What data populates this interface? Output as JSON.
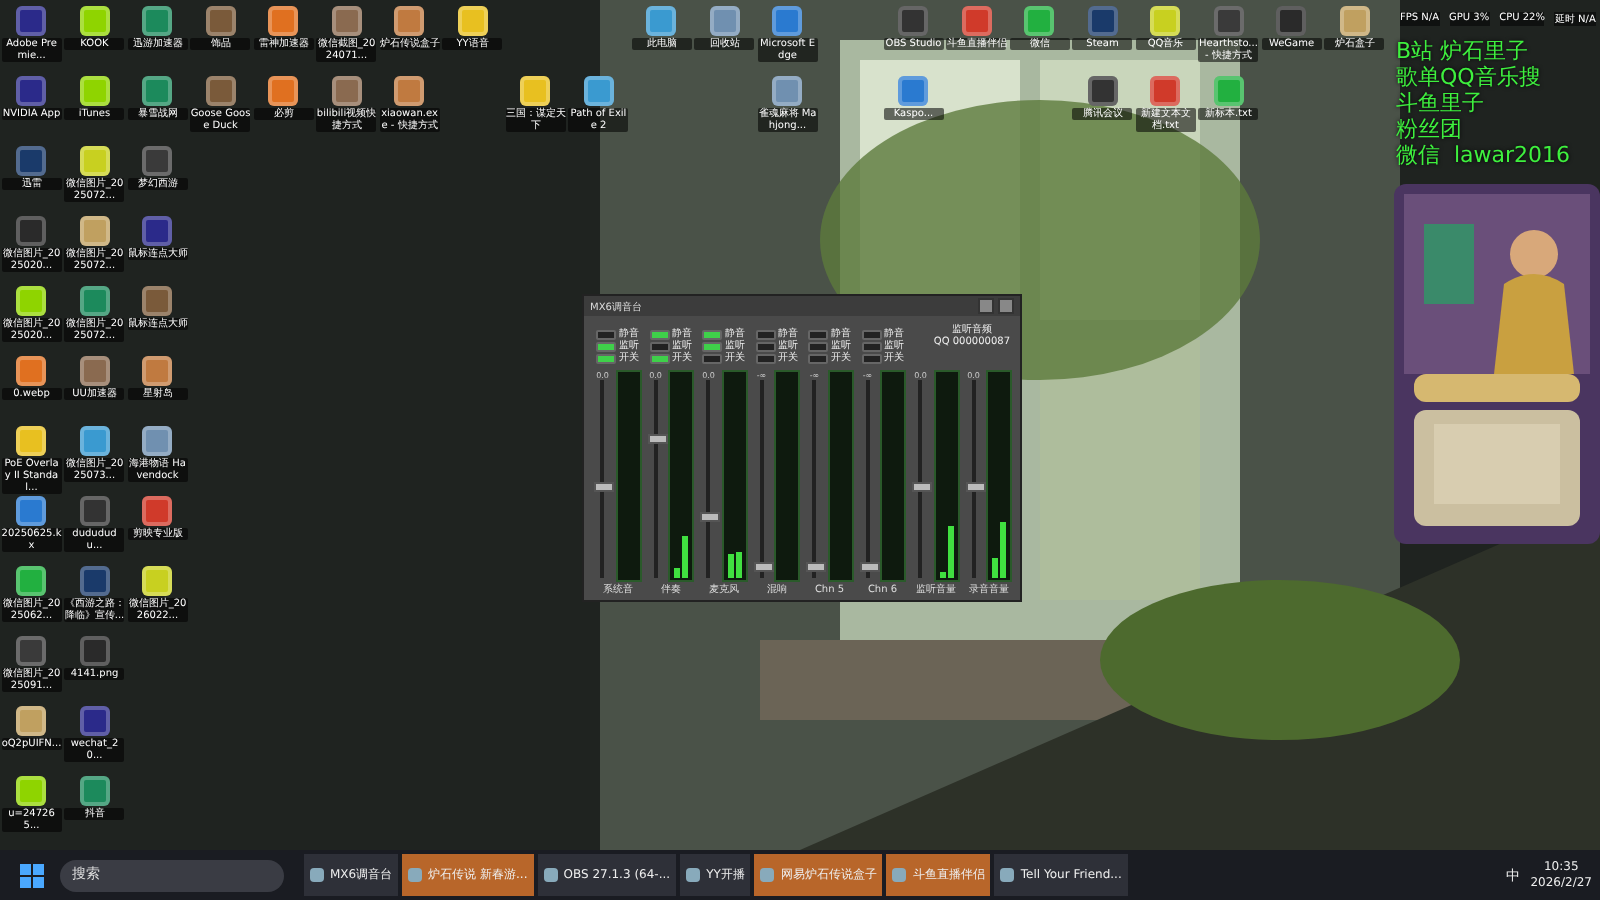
{
  "desktop_icons": [
    {
      "label": "Adobe Premie..."
    },
    {
      "label": "KOOK"
    },
    {
      "label": "迅游加速器"
    },
    {
      "label": "饰品"
    },
    {
      "label": "雷神加速器"
    },
    {
      "label": "微信截图_2024071..."
    },
    {
      "label": "炉石传说盒子"
    },
    {
      "label": "YY语音"
    },
    {
      "label": "此电脑"
    },
    {
      "label": "回收站"
    },
    {
      "label": "Microsoft Edge"
    },
    {
      "label": "OBS Studio"
    },
    {
      "label": "斗鱼直播伴侣"
    },
    {
      "label": "微信"
    },
    {
      "label": "Steam"
    },
    {
      "label": "QQ音乐"
    },
    {
      "label": "Hearthsto... - 快捷方式"
    },
    {
      "label": "WeGame"
    },
    {
      "label": "炉石盒子"
    },
    {
      "label": "NVIDIA App"
    },
    {
      "label": "iTunes"
    },
    {
      "label": "暴雪战网"
    },
    {
      "label": "Goose Goose Duck"
    },
    {
      "label": "必剪"
    },
    {
      "label": "bilibili视频快捷方式"
    },
    {
      "label": "xiaowan.exe - 快捷方式"
    },
    {
      "label": "三国：谋定天下"
    },
    {
      "label": "Path of Exile 2"
    },
    {
      "label": "雀魂麻将 Mahjong..."
    },
    {
      "label": "Kaspo..."
    },
    {
      "label": "腾讯会议"
    },
    {
      "label": "新建文本文档.txt"
    },
    {
      "label": "新标本.txt"
    },
    {
      "label": "迅雷"
    },
    {
      "label": "微信图片_2025072..."
    },
    {
      "label": "梦幻西游"
    },
    {
      "label": "微信图片_2025020..."
    },
    {
      "label": "微信图片_2025072..."
    },
    {
      "label": "鼠标连点大师"
    },
    {
      "label": "微信图片_2025020..."
    },
    {
      "label": "微信图片_2025072..."
    },
    {
      "label": "鼠标连点大师"
    },
    {
      "label": "0.webp"
    },
    {
      "label": "UU加速器"
    },
    {
      "label": "星射岛"
    },
    {
      "label": "PoE Overlay II Standal..."
    },
    {
      "label": "微信图片_2025073..."
    },
    {
      "label": "海港物语 Havendock"
    },
    {
      "label": "20250625.kx"
    },
    {
      "label": "dudududu..."
    },
    {
      "label": "剪映专业版"
    },
    {
      "label": "微信图片_2025062..."
    },
    {
      "label": "《西游之路：降临》宣传..."
    },
    {
      "label": "微信图片_2026022..."
    },
    {
      "label": "微信图片_2025091..."
    },
    {
      "label": "4141.png"
    },
    {
      "label": "oQ2pUIFN..."
    },
    {
      "label": "wechat_20..."
    },
    {
      "label": "u=247265..."
    },
    {
      "label": "抖音"
    }
  ],
  "stats": [
    {
      "label": "FPS",
      "value": "N/A"
    },
    {
      "label": "GPU",
      "value": "3%"
    },
    {
      "label": "CPU",
      "value": "22%"
    },
    {
      "label": "延时",
      "value": "N/A"
    }
  ],
  "overlay_lines": [
    "B站 炉石里子",
    "歌单QQ音乐搜",
    "斗鱼里子",
    "粉丝团",
    "微信  lawar2016"
  ],
  "mixer": {
    "title": "MX6调音台",
    "monitor_label": "监听音频",
    "monitor_value": "QQ 000000087",
    "channels": [
      {
        "name": "系统音",
        "reading": "0.0",
        "level": 0.45,
        "toggles": [
          {
            "label": "静音",
            "on": false
          },
          {
            "label": "监听",
            "on": true
          },
          {
            "label": "开关",
            "on": true
          }
        ]
      },
      {
        "name": "伴奏",
        "reading": "0.0",
        "level": 0.7,
        "meter": [
          {
            "level": 0.05
          },
          {
            "level": 0.2
          }
        ],
        "toggles": [
          {
            "label": "静音",
            "on": true
          },
          {
            "label": "监听",
            "on": false
          },
          {
            "label": "开关",
            "on": true
          }
        ]
      },
      {
        "name": "麦克风",
        "reading": "0.0",
        "level": 0.3,
        "meter": [
          {
            "level": 0.12
          },
          {
            "level": 0.13
          }
        ],
        "toggles": [
          {
            "label": "静音",
            "on": true
          },
          {
            "label": "监听",
            "on": true
          },
          {
            "label": "开关",
            "on": false
          }
        ]
      },
      {
        "name": "混响",
        "reading": "-∞",
        "level": 0.05,
        "toggles": [
          {
            "label": "静音",
            "on": false
          },
          {
            "label": "监听",
            "on": false
          },
          {
            "label": "开关",
            "on": false
          }
        ]
      },
      {
        "name": "Chn 5",
        "reading": "-∞",
        "level": 0.05,
        "toggles": [
          {
            "label": "静音",
            "on": false
          },
          {
            "label": "监听",
            "on": false
          },
          {
            "label": "开关",
            "on": false
          }
        ]
      },
      {
        "name": "Chn 6",
        "reading": "-∞",
        "level": 0.05,
        "toggles": [
          {
            "label": "静音",
            "on": false
          },
          {
            "label": "监听",
            "on": false
          },
          {
            "label": "开关",
            "on": false
          }
        ]
      },
      {
        "name": "监听音量",
        "reading": "0.0",
        "level": 0.45,
        "meter": [
          {
            "level": 0.03
          },
          {
            "level": 0.25
          }
        ]
      },
      {
        "name": "录音音量",
        "reading": "0.0",
        "level": 0.45,
        "meter": [
          {
            "level": 0.1
          },
          {
            "level": 0.27
          }
        ]
      }
    ]
  },
  "taskbar": {
    "search_placeholder": "搜索",
    "tasks": [
      {
        "label": "MX6调音台",
        "active": false
      },
      {
        "label": "炉石传说 新春游...",
        "active": true
      },
      {
        "label": "OBS 27.1.3 (64-...",
        "active": false
      },
      {
        "label": "YY开播",
        "active": false
      },
      {
        "label": "网易炉石传说盒子",
        "active": true
      },
      {
        "label": "斗鱼直播伴侣",
        "active": true
      },
      {
        "label": "Tell Your Friend...",
        "active": false
      }
    ],
    "ime": "中",
    "time": "10:35",
    "date": "2026/2/27"
  }
}
